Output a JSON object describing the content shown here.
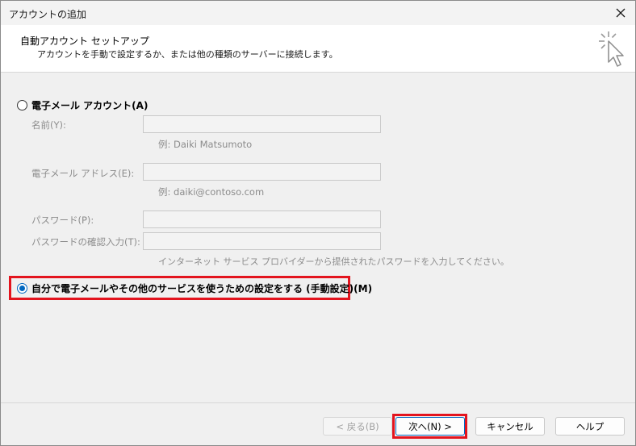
{
  "window": {
    "title": "アカウントの追加"
  },
  "header": {
    "title": "自動アカウント セットアップ",
    "description": "アカウントを手動で設定するか、または他の種類のサーバーに接続します。"
  },
  "email_account_option": {
    "label": "電子メール アカウント(A)",
    "selected": false,
    "fields": [
      {
        "label": "名前(Y):",
        "value": "",
        "example": "例: Daiki Matsumoto"
      },
      {
        "label": "電子メール アドレス(E):",
        "value": "",
        "example": "例: daiki@contoso.com"
      },
      {
        "label": "パスワード(P):",
        "value": ""
      },
      {
        "label": "パスワードの確認入力(T):",
        "value": ""
      }
    ],
    "password_hint": "インターネット サービス プロバイダーから提供されたパスワードを入力してください。"
  },
  "manual_option": {
    "label": "自分で電子メールやその他のサービスを使うための設定をする (手動設定)(M)",
    "selected": true
  },
  "buttons": {
    "back": "< 戻る(B)",
    "next": "次へ(N) >",
    "cancel": "キャンセル",
    "help": "ヘルプ"
  },
  "colors": {
    "highlight": "#e3141e",
    "accent": "#0067c0"
  }
}
